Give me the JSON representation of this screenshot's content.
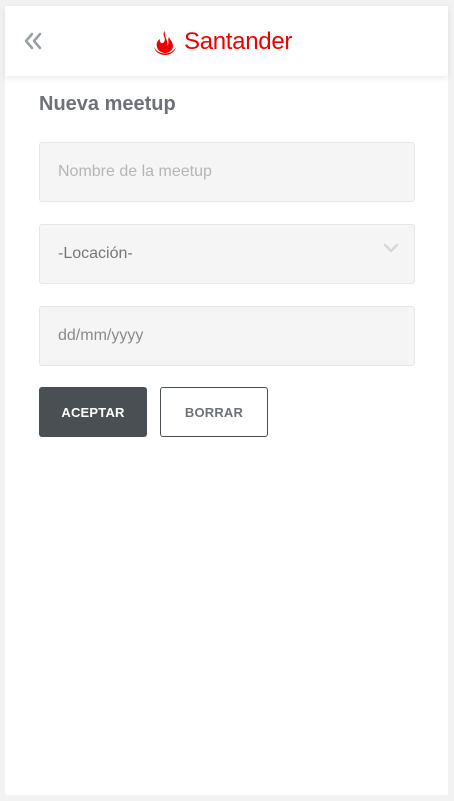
{
  "header": {
    "back_icon": "double-chevron-left-icon",
    "brand": "Santander",
    "brand_color": "#ec0000"
  },
  "form": {
    "title": "Nueva meetup",
    "name_placeholder": "Nombre de la meetup",
    "location_value": "-Locación-",
    "date_placeholder": "dd/mm/yyyy",
    "accept_label": "ACEPTAR",
    "clear_label": "BORRAR"
  },
  "colors": {
    "primary_button": "#4a4f54",
    "title_text": "#6e7278",
    "field_background": "#f5f5f5"
  }
}
